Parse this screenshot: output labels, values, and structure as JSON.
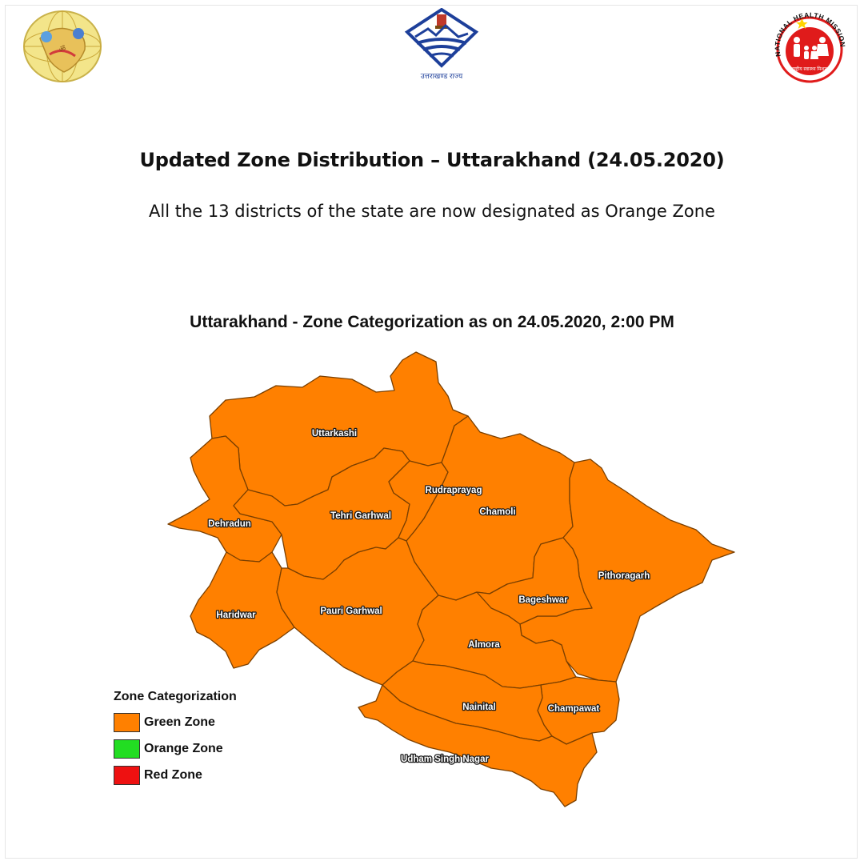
{
  "header": {
    "left_logo": {
      "name": "state-emblem-logo",
      "text": "ॐ"
    },
    "center_logo": {
      "name": "uttarakhand-govt-logo",
      "caption": "उत्तराखण्ड राज्य"
    },
    "right_logo": {
      "name": "national-health-mission-logo",
      "ring_text": "NATIONAL HEALTH MISSION",
      "caption": "राष्ट्रीय स्वास्थ्य मिशन"
    }
  },
  "main_title": "Updated Zone Distribution – Uttarakhand (24.05.2020)",
  "subtitle": "All the 13 districts of the state are now designated as Orange Zone",
  "map": {
    "title": "Uttarakhand - Zone Categorization as on 24.05.2020, 2:00 PM",
    "fill_color": "#FF8000",
    "border_color": "#7a3f00",
    "districts": [
      {
        "name": "Uttarkashi"
      },
      {
        "name": "Rudraprayag"
      },
      {
        "name": "Chamoli"
      },
      {
        "name": "Tehri Garhwal"
      },
      {
        "name": "Dehradun"
      },
      {
        "name": "Pithoragarh"
      },
      {
        "name": "Bageshwar"
      },
      {
        "name": "Haridwar"
      },
      {
        "name": "Pauri Garhwal"
      },
      {
        "name": "Almora"
      },
      {
        "name": "Nainital"
      },
      {
        "name": "Champawat"
      },
      {
        "name": "Udham Singh Nagar"
      }
    ]
  },
  "legend": {
    "title": "Zone Categorization",
    "items": [
      {
        "label": "Green Zone",
        "color": "#FF8000"
      },
      {
        "label": "Orange Zone",
        "color": "#22DD22"
      },
      {
        "label": "Red Zone",
        "color": "#EE1111"
      }
    ]
  }
}
